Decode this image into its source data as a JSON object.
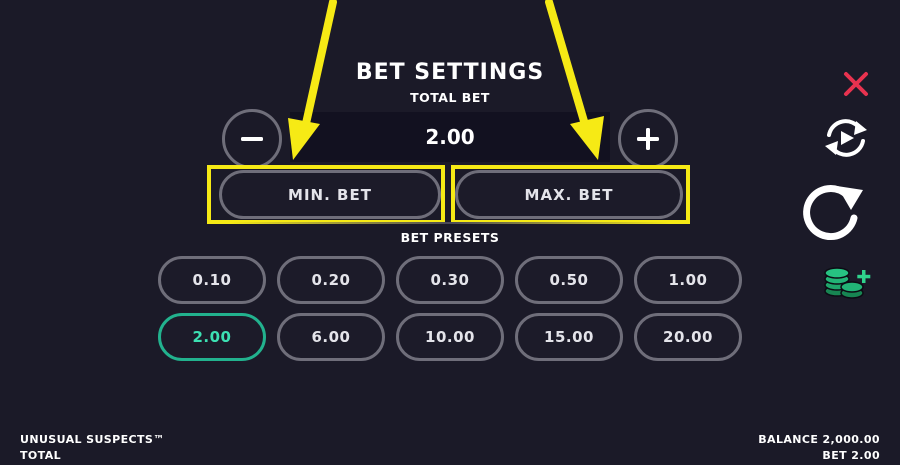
{
  "header": {
    "title": "BET SETTINGS",
    "subtitle": "TOTAL BET"
  },
  "bet": {
    "value": "2.00"
  },
  "buttons": {
    "min_bet": "MIN. BET",
    "max_bet": "MAX. BET"
  },
  "presets": {
    "label": "BET PRESETS",
    "row1": [
      "0.10",
      "0.20",
      "0.30",
      "0.50",
      "1.00"
    ],
    "row2": [
      "2.00",
      "6.00",
      "10.00",
      "15.00",
      "20.00"
    ],
    "selected": "2.00"
  },
  "side_icons": [
    "close-icon",
    "autoplay-icon",
    "spin-icon",
    "buy-coins-icon"
  ],
  "footer": {
    "game_name": "UNUSUAL SUSPECTS™",
    "total_label": "TOTAL",
    "balance": "BALANCE 2,000.00",
    "bet": "BET 2.00"
  },
  "colors": {
    "background": "#1b1a28",
    "annotation": "#f6ea15",
    "selected": "#22b28e",
    "close": "#e8324f",
    "coins": "#1fa56b"
  }
}
